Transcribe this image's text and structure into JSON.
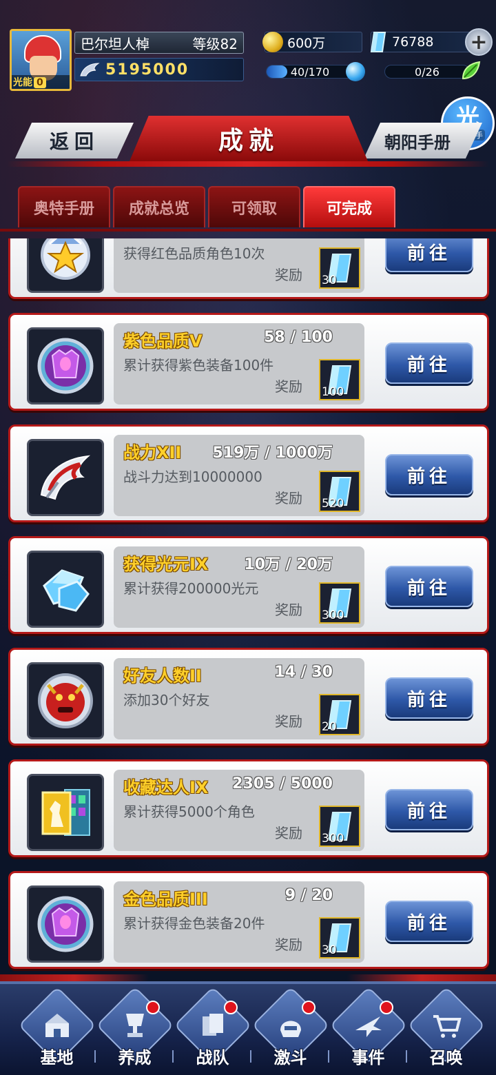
{
  "player": {
    "name": "巴尔坦人棹",
    "level": "等级82",
    "energy_label": "光能",
    "energy_value": "0",
    "power": "5195000"
  },
  "resources": {
    "gold": "600万",
    "gems": "76788",
    "energy_bar": "40/170",
    "energy_fraction": 0.235,
    "stamina_bar": "0/26"
  },
  "helper": {
    "glyph": "光",
    "label": "光环助手"
  },
  "header": {
    "back_label": "返回",
    "title": "成就",
    "right_tab": "朝阳手册"
  },
  "subtabs": [
    {
      "label": "奥特手册",
      "active": false
    },
    {
      "label": "成就总览",
      "active": false
    },
    {
      "label": "可领取",
      "active": false
    },
    {
      "label": "可完成",
      "active": true
    }
  ],
  "achievements": [
    {
      "name": "",
      "progress": "",
      "desc": "获得红色品质角色10次",
      "reward_label": "奖励",
      "reward_qty": "30",
      "button": "前往",
      "icon": "gold-star-medal-icon"
    },
    {
      "name": "紫色品质V",
      "progress": "58 / 100",
      "desc": "累计获得紫色装备100件",
      "reward_label": "奖励",
      "reward_qty": "100",
      "button": "前往",
      "icon": "purple-armor-icon"
    },
    {
      "name": "战力XII",
      "progress": "519万 / 1000万",
      "desc": "战斗力达到10000000",
      "reward_label": "奖励",
      "reward_qty": "520",
      "button": "前往",
      "icon": "wing-power-icon"
    },
    {
      "name": "获得光元IX",
      "progress": "10万 / 20万",
      "desc": "累计获得200000光元",
      "reward_label": "奖励",
      "reward_qty": "300",
      "button": "前往",
      "icon": "crystal-icon"
    },
    {
      "name": "好友人数II",
      "progress": "14 / 30",
      "desc": "添加30个好友",
      "reward_label": "奖励",
      "reward_qty": "20",
      "button": "前往",
      "icon": "monster-face-icon"
    },
    {
      "name": "收藏达人IX",
      "progress": "2305 / 5000",
      "desc": "累计获得5000个角色",
      "reward_label": "奖励",
      "reward_qty": "300",
      "button": "前往",
      "icon": "collection-cards-icon"
    },
    {
      "name": "金色品质III",
      "progress": "9 / 20",
      "desc": "累计获得金色装备20件",
      "reward_label": "奖励",
      "reward_qty": "30",
      "button": "前往",
      "icon": "purple-armor-icon"
    }
  ],
  "nav": [
    {
      "label": "基地",
      "dot": false,
      "icon": "base-icon"
    },
    {
      "label": "养成",
      "dot": true,
      "icon": "trophy-icon"
    },
    {
      "label": "战队",
      "dot": true,
      "icon": "cards-icon"
    },
    {
      "label": "激斗",
      "dot": true,
      "icon": "helmet-icon"
    },
    {
      "label": "事件",
      "dot": true,
      "icon": "jet-icon"
    },
    {
      "label": "召唤",
      "dot": false,
      "icon": "cart-icon"
    }
  ],
  "colors": {
    "accent_red": "#b51919",
    "tab_active": "#ff3a3a",
    "button_blue": "#2e58a8",
    "gold_text": "#ffd02a"
  }
}
